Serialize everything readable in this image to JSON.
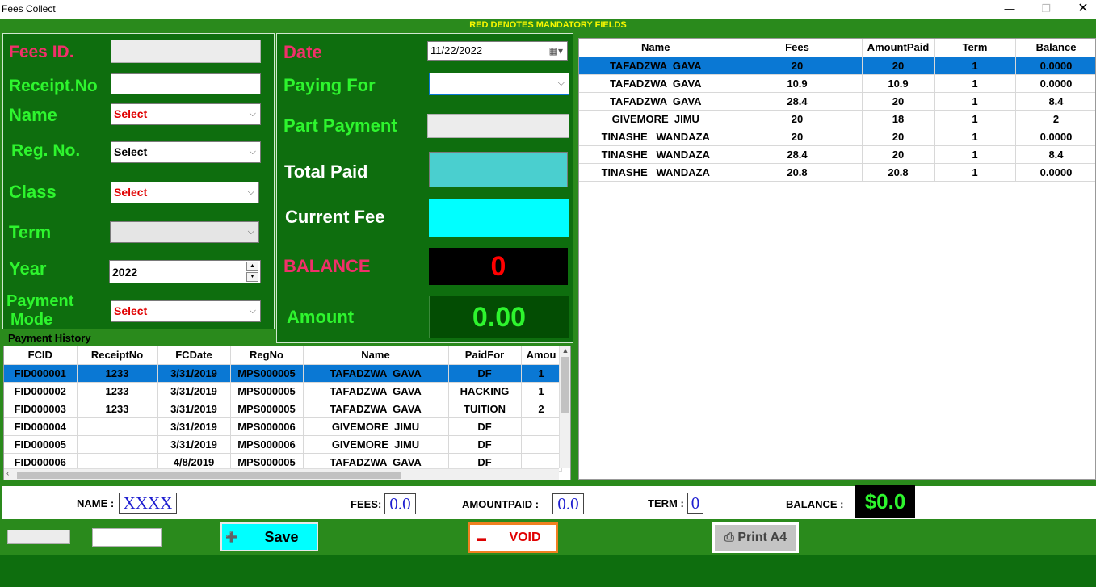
{
  "window": {
    "title": "Fees Collect"
  },
  "banner": "RED DENOTES MANDATORY FIELDS",
  "form": {
    "fees_id_label": "Fees ID.",
    "receipt_label": "Receipt.No",
    "name_label": "Name",
    "name_value": "Select",
    "regno_label": "Reg. No.",
    "regno_value": "Select",
    "class_label": "Class",
    "class_value": "Select",
    "term_label": "Term",
    "year_label": "Year",
    "year_value": "2022",
    "payment_mode_label_1": "Payment",
    "payment_mode_label_2": "Mode",
    "payment_mode_value": "Select"
  },
  "payment": {
    "date_label": "Date",
    "date_value": "11/22/2022",
    "paying_for_label": "Paying For",
    "part_payment_label": "Part Payment",
    "total_paid_label": "Total Paid",
    "current_fee_label": "Current Fee",
    "balance_label": "BALANCE",
    "balance_value": "0",
    "amount_label": "Amount",
    "amount_value": "0.00"
  },
  "history": {
    "title": "Payment History",
    "columns": [
      "FCID",
      "ReceiptNo",
      "FCDate",
      "RegNo",
      "Name",
      "PaidFor",
      "Amou"
    ],
    "rows": [
      [
        "FID000001",
        "1233",
        "3/31/2019",
        "MPS000005",
        "TAFADZWA  GAVA",
        "DF",
        "1"
      ],
      [
        "FID000002",
        "1233",
        "3/31/2019",
        "MPS000005",
        "TAFADZWA  GAVA",
        "HACKING",
        "1"
      ],
      [
        "FID000003",
        "1233",
        "3/31/2019",
        "MPS000005",
        "TAFADZWA  GAVA",
        "TUITION",
        "2"
      ],
      [
        "FID000004",
        "",
        "3/31/2019",
        "MPS000006",
        "GIVEMORE  JIMU",
        "DF",
        ""
      ],
      [
        "FID000005",
        "",
        "3/31/2019",
        "MPS000006",
        "GIVEMORE  JIMU",
        "DF",
        ""
      ],
      [
        "FID000006",
        "",
        "4/8/2019",
        "MPS000005",
        "TAFADZWA  GAVA",
        "DF",
        ""
      ]
    ]
  },
  "balances": {
    "columns": [
      "Name",
      "Fees",
      "AmountPaid",
      "Term",
      "Balance"
    ],
    "rows": [
      [
        "TAFADZWA  GAVA",
        "20",
        "20",
        "1",
        "0.0000"
      ],
      [
        "TAFADZWA  GAVA",
        "10.9",
        "10.9",
        "1",
        "0.0000"
      ],
      [
        "TAFADZWA  GAVA",
        "28.4",
        "20",
        "1",
        "8.4"
      ],
      [
        "GIVEMORE  JIMU",
        "20",
        "18",
        "1",
        "2"
      ],
      [
        "TINASHE   WANDAZA",
        "20",
        "20",
        "1",
        "0.0000"
      ],
      [
        "TINASHE   WANDAZA",
        "28.4",
        "20",
        "1",
        "8.4"
      ],
      [
        "TINASHE   WANDAZA",
        "20.8",
        "20.8",
        "1",
        "0.0000"
      ]
    ]
  },
  "summary": {
    "name_label": "NAME :",
    "name_value": "XXXX",
    "fees_label": "FEES:",
    "fees_value": "0.0",
    "amountpaid_label": "AMOUNTPAID :",
    "amountpaid_value": "0.0",
    "term_label": "TERM :",
    "term_value": "0",
    "balance_label": "BALANCE :",
    "balance_value": "$0.0"
  },
  "buttons": {
    "save": "Save",
    "void": "VOID",
    "print": "Print A4"
  },
  "icons": {
    "minimize": "minimize-icon",
    "restore": "restore-icon",
    "close": "close-icon"
  },
  "colors": {
    "background_green": "#2a8a1c",
    "panel_green": "#0e6e0e",
    "label_green": "#2ef52e",
    "mandatory_red": "#f0306a",
    "selection_blue": "#0a78d4"
  }
}
